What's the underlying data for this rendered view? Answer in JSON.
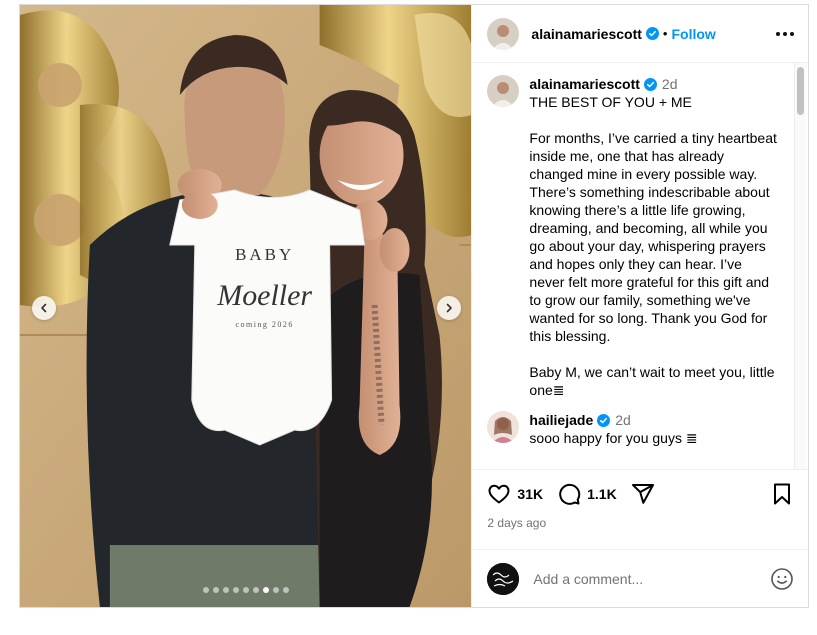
{
  "post": {
    "username": "alainamariescott",
    "follow_label": "Follow",
    "separator": "•",
    "carousel": {
      "total": 9,
      "active_index": 6
    }
  },
  "caption": {
    "username": "alainamariescott",
    "time": "2d",
    "text": "THE BEST OF YOU + ME\n\nFor months, I’ve carried a tiny heartbeat inside me, one that has already changed mine in every possible way. There’s something indescribable about knowing there’s a little life growing, dreaming, and becoming, all while you go about your day, whispering prayers and hopes only they can hear. I’ve never felt more grateful for this gift and to grow our family, something we've wanted for so long. Thank you God for this blessing.\n\nBaby M, we can’t wait to meet you, little one≣"
  },
  "comments": [
    {
      "username": "hailiejade",
      "time": "2d",
      "text": "sooo happy for you guys ≣"
    }
  ],
  "stats": {
    "likes": "31K",
    "comments": "1.1K",
    "ago": "2 days ago"
  },
  "add_comment": {
    "placeholder": "Add a comment..."
  },
  "photo": {
    "onesie_line1": "BABY",
    "onesie_line2": "Moeller",
    "onesie_line3": "coming 2026"
  },
  "colors": {
    "accent": "#0095f6",
    "verified": "#0095f6",
    "muted": "#737373"
  },
  "icons": [
    "heart-icon",
    "comment-icon",
    "share-icon",
    "bookmark-icon",
    "emoji-icon",
    "more-icon",
    "chevron-left-icon",
    "chevron-right-icon",
    "verified-icon"
  ]
}
